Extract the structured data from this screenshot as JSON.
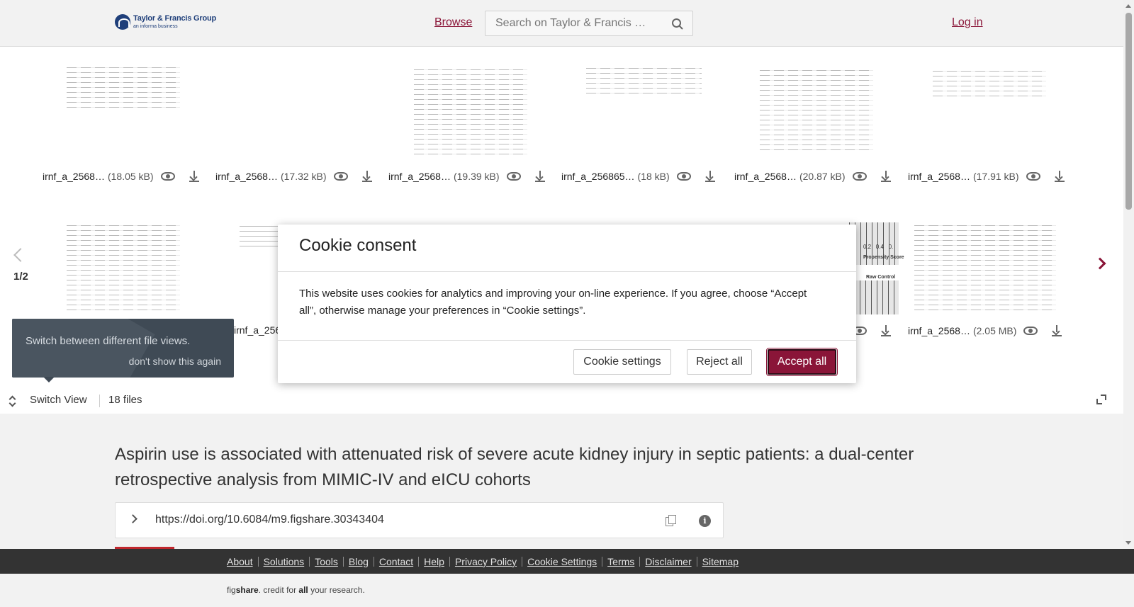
{
  "header": {
    "logo_title": "Taylor & Francis Group",
    "logo_subtitle": "an informa business",
    "browse_label": "Browse",
    "search_placeholder": "Search on Taylor & Francis …",
    "login_label": "Log in"
  },
  "files": {
    "row1": [
      {
        "name": "irnf_a_2568…",
        "size": "(18.05 kB)"
      },
      {
        "name": "irnf_a_2568…",
        "size": "(17.32 kB)"
      },
      {
        "name": "irnf_a_2568…",
        "size": "(19.39 kB)"
      },
      {
        "name": "irnf_a_256865…",
        "size": "(18 kB)"
      },
      {
        "name": "irnf_a_2568…",
        "size": "(20.87 kB)"
      },
      {
        "name": "irnf_a_2568…",
        "size": "(17.91 kB)"
      }
    ],
    "row2": [
      {
        "name": "irnf_a_2568…",
        "size": ""
      },
      {
        "name": "irnf_a_2568…",
        "size": "(2.05 MB)"
      }
    ],
    "chart_labels": {
      "propensity": "Propensity Score",
      "raw_control": "Raw Control",
      "axis_ticks": "0.2   0.4   0."
    },
    "pager": "1/2"
  },
  "tooltip": {
    "text": "Switch between different file views.",
    "dismiss": "don't show this again"
  },
  "switch_bar": {
    "label": "Switch View",
    "count": "18 files"
  },
  "article": {
    "title": "Aspirin use is associated with attenuated risk of severe acute kidney injury in septic patients: a dual-center retrospective analysis from MIMIC-IV and eICU cohorts",
    "doi": "https://doi.org/10.6084/m9.figshare.30343404",
    "info_symbol": "i"
  },
  "footer": {
    "links": [
      "About",
      "Solutions",
      "Tools",
      "Blog",
      "Contact",
      "Help",
      "Privacy Policy",
      "Cookie Settings",
      "Terms",
      "Disclaimer",
      "Sitemap"
    ],
    "tagline_prefix": "fig",
    "tagline_brand": "share",
    "tagline_mid": ". credit for ",
    "tagline_all": "all",
    "tagline_end": " your research."
  },
  "cookie_modal": {
    "title": "Cookie consent",
    "body": "This website uses cookies for analytics and improving your on-line experience. If you agree, choose “Accept all”, otherwise manage your preferences in “Cookie settings”.",
    "settings_label": "Cookie settings",
    "reject_label": "Reject all",
    "accept_label": "Accept all"
  },
  "colors": {
    "brand": "#8a1538",
    "footer_bg": "#333333",
    "tooltip_bg": "#3f4a55"
  }
}
